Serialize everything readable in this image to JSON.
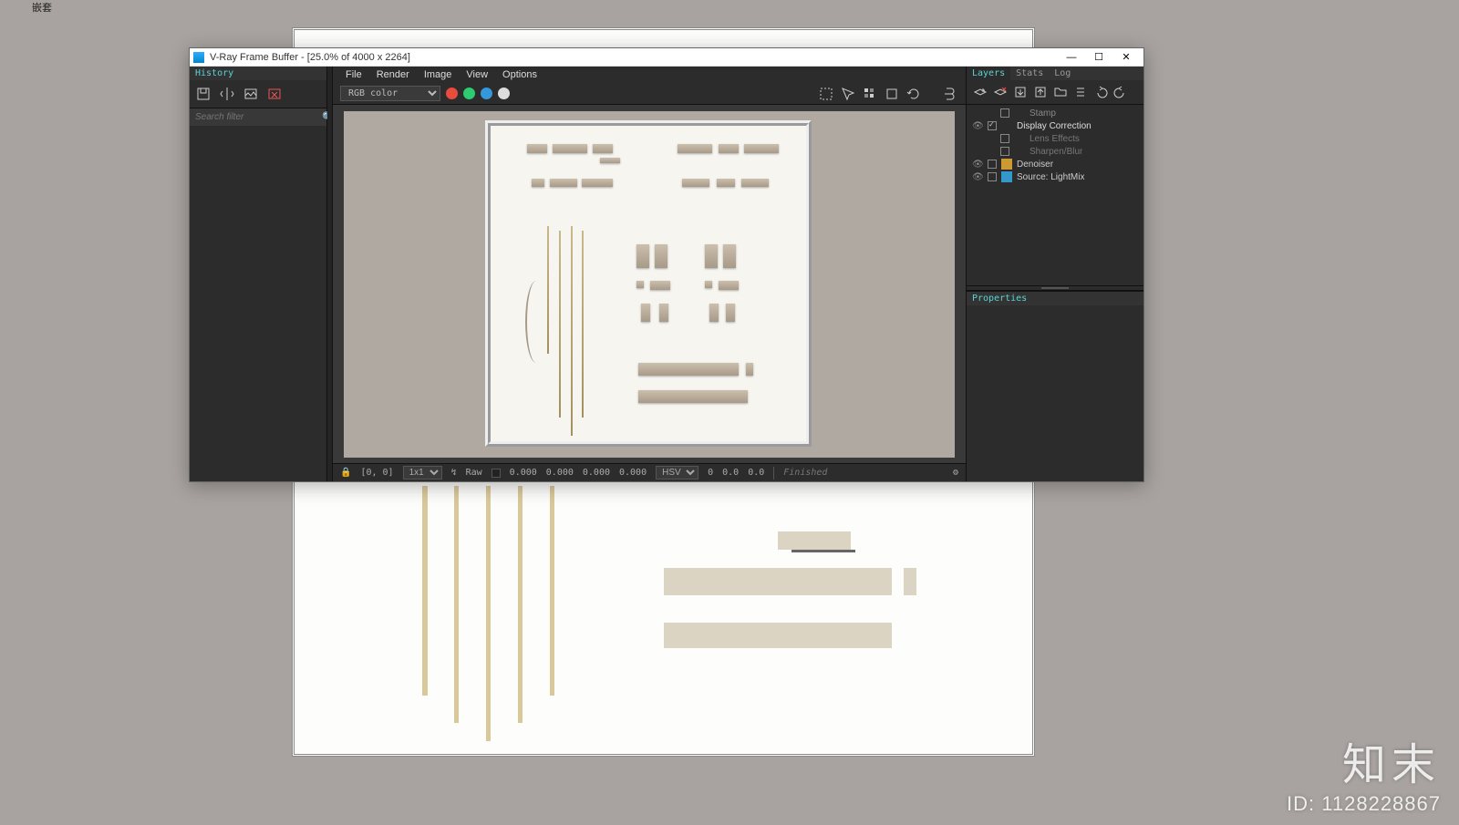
{
  "topleft_label": "嵌套",
  "window": {
    "title": "V-Ray Frame Buffer - [25.0% of 4000 x 2264]",
    "controls": {
      "min": "—",
      "max": "☐",
      "close": "✕"
    }
  },
  "left_panel": {
    "header": "History",
    "search_placeholder": "Search filter"
  },
  "menu": {
    "file": "File",
    "render": "Render",
    "image": "Image",
    "view": "View",
    "options": "Options"
  },
  "channel_select": "RGB color",
  "statusbar": {
    "lock": "🔒",
    "coords": "[0, 0]",
    "zoom": "1x1",
    "raw": "Raw",
    "c1": "0.000",
    "c2": "0.000",
    "c3": "0.000",
    "c4": "0.000",
    "mode": "HSV",
    "h": "0",
    "s": "0.0",
    "v": "0.0",
    "status": "Finished"
  },
  "right_panel": {
    "tabs": {
      "layers": "Layers",
      "stats": "Stats",
      "log": "Log"
    },
    "layers": [
      {
        "eye": false,
        "chk": false,
        "name": "Stamp",
        "color": "#888",
        "indent": true
      },
      {
        "eye": true,
        "chk": true,
        "name": "Display Correction",
        "color": "#ddd",
        "indent": false
      },
      {
        "eye": false,
        "chk": false,
        "name": "Lens Effects",
        "color": "#777",
        "indent": true
      },
      {
        "eye": false,
        "chk": false,
        "name": "Sharpen/Blur",
        "color": "#777",
        "indent": true
      },
      {
        "eye": true,
        "chk": false,
        "name": "Denoiser",
        "color": "#ccc",
        "indent": false,
        "icon": "#c93"
      },
      {
        "eye": true,
        "chk": false,
        "name": "Source: LightMix",
        "color": "#ccc",
        "indent": false,
        "icon": "#39c"
      }
    ],
    "properties": "Properties"
  },
  "watermark": {
    "logo": "知末",
    "id": "ID: 1128228867"
  }
}
